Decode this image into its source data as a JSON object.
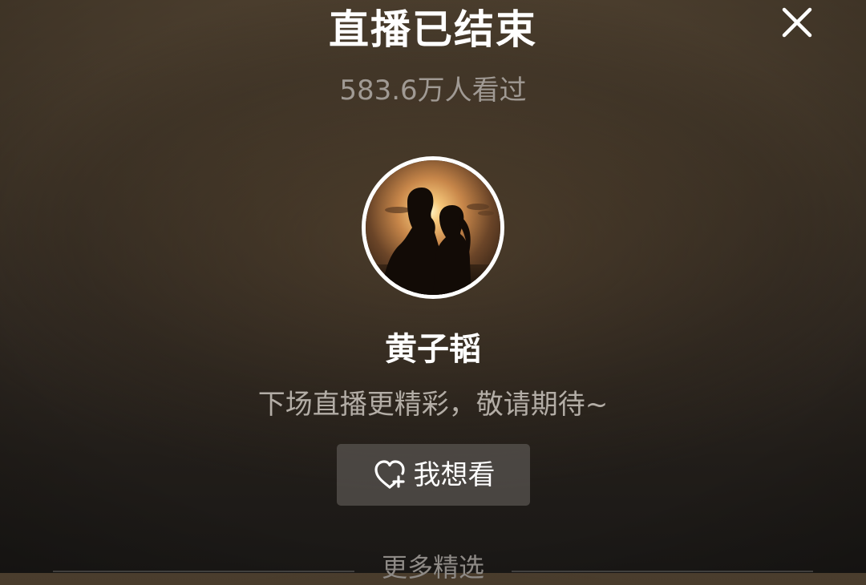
{
  "header": {
    "title": "直播已结束",
    "close_icon": "close-icon"
  },
  "stats": {
    "viewers_text": "583.6万人看过"
  },
  "host": {
    "avatar_icon": "host-avatar",
    "name": "黄子韬"
  },
  "message": {
    "subtitle": "下场直播更精彩，敬请期待~"
  },
  "actions": {
    "want_icon": "heart-plus-icon",
    "want_label": "我想看"
  },
  "more": {
    "label": "更多精选"
  },
  "colors": {
    "background_top": "#4a3d2d",
    "background_bottom": "#1a1816",
    "title": "#ffffff",
    "secondary_text": "#a09a94",
    "button_bg": "#5a5652"
  }
}
